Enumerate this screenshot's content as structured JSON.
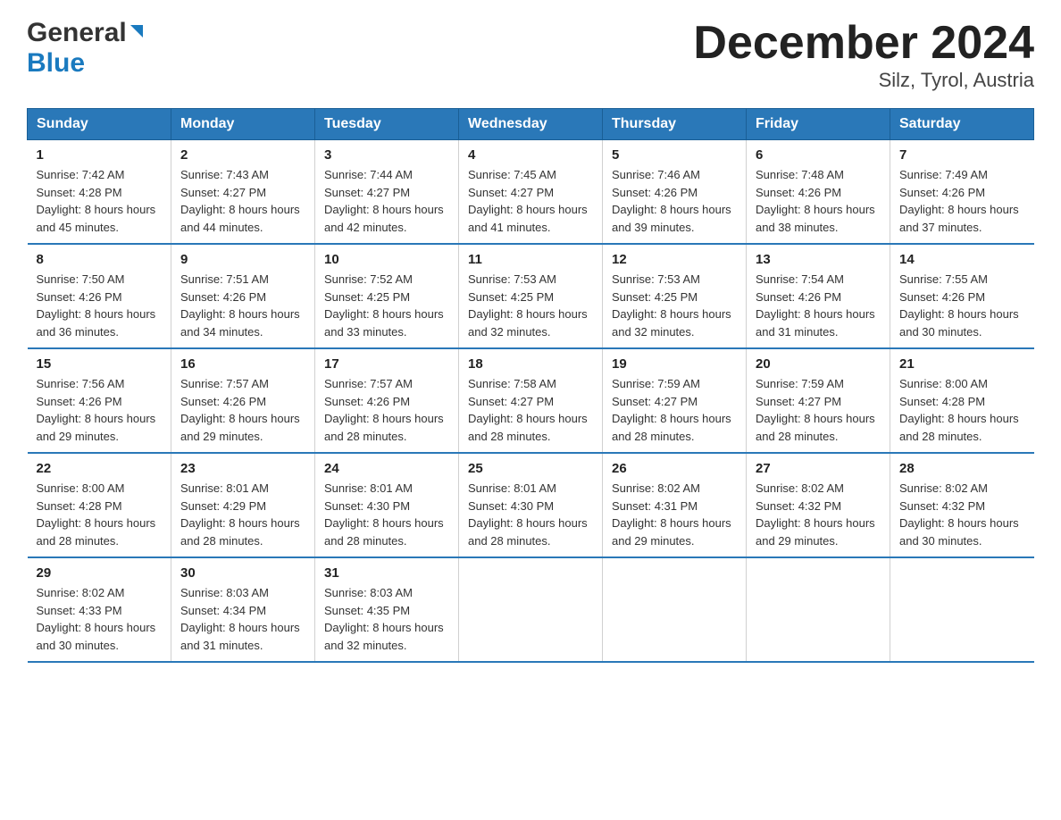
{
  "header": {
    "logo_general": "General",
    "logo_blue": "Blue",
    "title": "December 2024",
    "subtitle": "Silz, Tyrol, Austria"
  },
  "days_of_week": [
    "Sunday",
    "Monday",
    "Tuesday",
    "Wednesday",
    "Thursday",
    "Friday",
    "Saturday"
  ],
  "weeks": [
    [
      {
        "day": "1",
        "sunrise": "7:42 AM",
        "sunset": "4:28 PM",
        "daylight": "8 hours and 45 minutes."
      },
      {
        "day": "2",
        "sunrise": "7:43 AM",
        "sunset": "4:27 PM",
        "daylight": "8 hours and 44 minutes."
      },
      {
        "day": "3",
        "sunrise": "7:44 AM",
        "sunset": "4:27 PM",
        "daylight": "8 hours and 42 minutes."
      },
      {
        "day": "4",
        "sunrise": "7:45 AM",
        "sunset": "4:27 PM",
        "daylight": "8 hours and 41 minutes."
      },
      {
        "day": "5",
        "sunrise": "7:46 AM",
        "sunset": "4:26 PM",
        "daylight": "8 hours and 39 minutes."
      },
      {
        "day": "6",
        "sunrise": "7:48 AM",
        "sunset": "4:26 PM",
        "daylight": "8 hours and 38 minutes."
      },
      {
        "day": "7",
        "sunrise": "7:49 AM",
        "sunset": "4:26 PM",
        "daylight": "8 hours and 37 minutes."
      }
    ],
    [
      {
        "day": "8",
        "sunrise": "7:50 AM",
        "sunset": "4:26 PM",
        "daylight": "8 hours and 36 minutes."
      },
      {
        "day": "9",
        "sunrise": "7:51 AM",
        "sunset": "4:26 PM",
        "daylight": "8 hours and 34 minutes."
      },
      {
        "day": "10",
        "sunrise": "7:52 AM",
        "sunset": "4:25 PM",
        "daylight": "8 hours and 33 minutes."
      },
      {
        "day": "11",
        "sunrise": "7:53 AM",
        "sunset": "4:25 PM",
        "daylight": "8 hours and 32 minutes."
      },
      {
        "day": "12",
        "sunrise": "7:53 AM",
        "sunset": "4:25 PM",
        "daylight": "8 hours and 32 minutes."
      },
      {
        "day": "13",
        "sunrise": "7:54 AM",
        "sunset": "4:26 PM",
        "daylight": "8 hours and 31 minutes."
      },
      {
        "day": "14",
        "sunrise": "7:55 AM",
        "sunset": "4:26 PM",
        "daylight": "8 hours and 30 minutes."
      }
    ],
    [
      {
        "day": "15",
        "sunrise": "7:56 AM",
        "sunset": "4:26 PM",
        "daylight": "8 hours and 29 minutes."
      },
      {
        "day": "16",
        "sunrise": "7:57 AM",
        "sunset": "4:26 PM",
        "daylight": "8 hours and 29 minutes."
      },
      {
        "day": "17",
        "sunrise": "7:57 AM",
        "sunset": "4:26 PM",
        "daylight": "8 hours and 28 minutes."
      },
      {
        "day": "18",
        "sunrise": "7:58 AM",
        "sunset": "4:27 PM",
        "daylight": "8 hours and 28 minutes."
      },
      {
        "day": "19",
        "sunrise": "7:59 AM",
        "sunset": "4:27 PM",
        "daylight": "8 hours and 28 minutes."
      },
      {
        "day": "20",
        "sunrise": "7:59 AM",
        "sunset": "4:27 PM",
        "daylight": "8 hours and 28 minutes."
      },
      {
        "day": "21",
        "sunrise": "8:00 AM",
        "sunset": "4:28 PM",
        "daylight": "8 hours and 28 minutes."
      }
    ],
    [
      {
        "day": "22",
        "sunrise": "8:00 AM",
        "sunset": "4:28 PM",
        "daylight": "8 hours and 28 minutes."
      },
      {
        "day": "23",
        "sunrise": "8:01 AM",
        "sunset": "4:29 PM",
        "daylight": "8 hours and 28 minutes."
      },
      {
        "day": "24",
        "sunrise": "8:01 AM",
        "sunset": "4:30 PM",
        "daylight": "8 hours and 28 minutes."
      },
      {
        "day": "25",
        "sunrise": "8:01 AM",
        "sunset": "4:30 PM",
        "daylight": "8 hours and 28 minutes."
      },
      {
        "day": "26",
        "sunrise": "8:02 AM",
        "sunset": "4:31 PM",
        "daylight": "8 hours and 29 minutes."
      },
      {
        "day": "27",
        "sunrise": "8:02 AM",
        "sunset": "4:32 PM",
        "daylight": "8 hours and 29 minutes."
      },
      {
        "day": "28",
        "sunrise": "8:02 AM",
        "sunset": "4:32 PM",
        "daylight": "8 hours and 30 minutes."
      }
    ],
    [
      {
        "day": "29",
        "sunrise": "8:02 AM",
        "sunset": "4:33 PM",
        "daylight": "8 hours and 30 minutes."
      },
      {
        "day": "30",
        "sunrise": "8:03 AM",
        "sunset": "4:34 PM",
        "daylight": "8 hours and 31 minutes."
      },
      {
        "day": "31",
        "sunrise": "8:03 AM",
        "sunset": "4:35 PM",
        "daylight": "8 hours and 32 minutes."
      },
      null,
      null,
      null,
      null
    ]
  ],
  "labels": {
    "sunrise": "Sunrise:",
    "sunset": "Sunset:",
    "daylight": "Daylight:"
  }
}
